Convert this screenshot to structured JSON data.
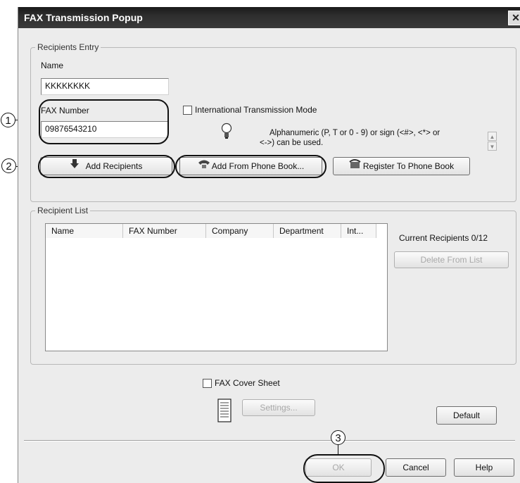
{
  "window": {
    "title": "FAX Transmission Popup",
    "close_glyph": "✕"
  },
  "recipients_entry": {
    "legend": "Recipients Entry",
    "name_label": "Name",
    "name_value": "KKKKKKKK",
    "fax_number_label": "FAX Number",
    "fax_number_value": "09876543210",
    "international_mode_label": "International Transmission Mode",
    "hint_text_line1": "Alphanumeric (P, T or 0 - 9) or sign (<#>, <*> or",
    "hint_text_line2": "<->) can be used.",
    "add_recipients_label": "Add Recipients",
    "add_from_phone_book_label": "Add From Phone Book...",
    "register_to_phone_book_label": "Register To Phone Book"
  },
  "recipient_list": {
    "legend": "Recipient List",
    "columns": [
      "Name",
      "FAX Number",
      "Company",
      "Department",
      "Int..."
    ],
    "rows": [],
    "current_recipients": "Current Recipients 0/12",
    "delete_label": "Delete From List"
  },
  "cover_sheet": {
    "checkbox_label": "FAX Cover Sheet",
    "settings_label": "Settings...",
    "default_label": "Default"
  },
  "footer": {
    "ok_label": "OK",
    "cancel_label": "Cancel",
    "help_label": "Help"
  },
  "callouts": [
    "1",
    "2",
    "3"
  ],
  "icons": [
    "arrow-down-icon",
    "phone-book-icon",
    "register-phone-book-icon",
    "lightbulb-icon",
    "document-icon"
  ]
}
